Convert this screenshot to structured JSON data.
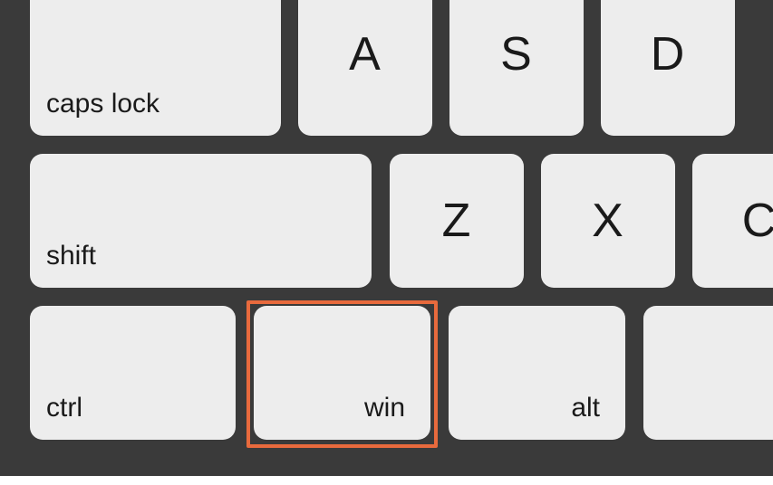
{
  "keys": {
    "caps_lock": "caps lock",
    "a": "A",
    "s": "S",
    "d": "D",
    "shift": "shift",
    "z": "Z",
    "x": "X",
    "c": "C",
    "ctrl": "ctrl",
    "win": "win",
    "alt": "alt"
  },
  "highlighted_key": "win",
  "colors": {
    "key_bg": "#ededed",
    "board_bg": "#3a3a3a",
    "highlight": "#e86a3d"
  }
}
